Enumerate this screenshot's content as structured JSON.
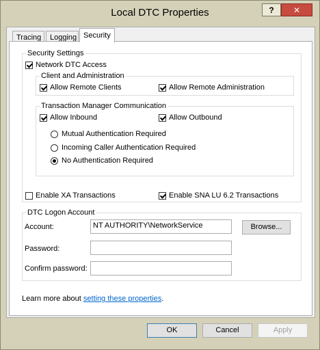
{
  "window": {
    "title": "Local DTC Properties",
    "help_label": "?",
    "close_label": "✕"
  },
  "tabs": [
    {
      "label": "Tracing"
    },
    {
      "label": "Logging"
    },
    {
      "label": "Security",
      "active": true
    }
  ],
  "security_settings": {
    "group_label": "Security Settings",
    "network_dtc_access": {
      "label": "Network DTC Access",
      "checked": true
    },
    "client_admin": {
      "group_label": "Client and Administration",
      "allow_remote_clients": {
        "label": "Allow Remote Clients",
        "checked": true
      },
      "allow_remote_admin": {
        "label": "Allow Remote Administration",
        "checked": true
      }
    },
    "tm_comm": {
      "group_label": "Transaction Manager Communication",
      "allow_inbound": {
        "label": "Allow Inbound",
        "checked": true
      },
      "allow_outbound": {
        "label": "Allow Outbound",
        "checked": true
      },
      "auth_options": [
        {
          "label": "Mutual Authentication Required",
          "selected": false
        },
        {
          "label": "Incoming Caller Authentication Required",
          "selected": false
        },
        {
          "label": "No Authentication Required",
          "selected": true
        }
      ]
    },
    "enable_xa": {
      "label": "Enable XA Transactions",
      "checked": false
    },
    "enable_sna": {
      "label": "Enable SNA LU 6.2 Transactions",
      "checked": true
    }
  },
  "logon_account": {
    "group_label": "DTC Logon Account",
    "account_label": "Account:",
    "account_value": "NT AUTHORITY\\NetworkService",
    "browse_label": "Browse...",
    "password_label": "Password:",
    "password_value": "",
    "confirm_label": "Confirm password:",
    "confirm_value": ""
  },
  "learn_more": {
    "prefix": "Learn more about ",
    "link": "setting these properties",
    "suffix": "."
  },
  "buttons": {
    "ok": "OK",
    "cancel": "Cancel",
    "apply": "Apply"
  }
}
